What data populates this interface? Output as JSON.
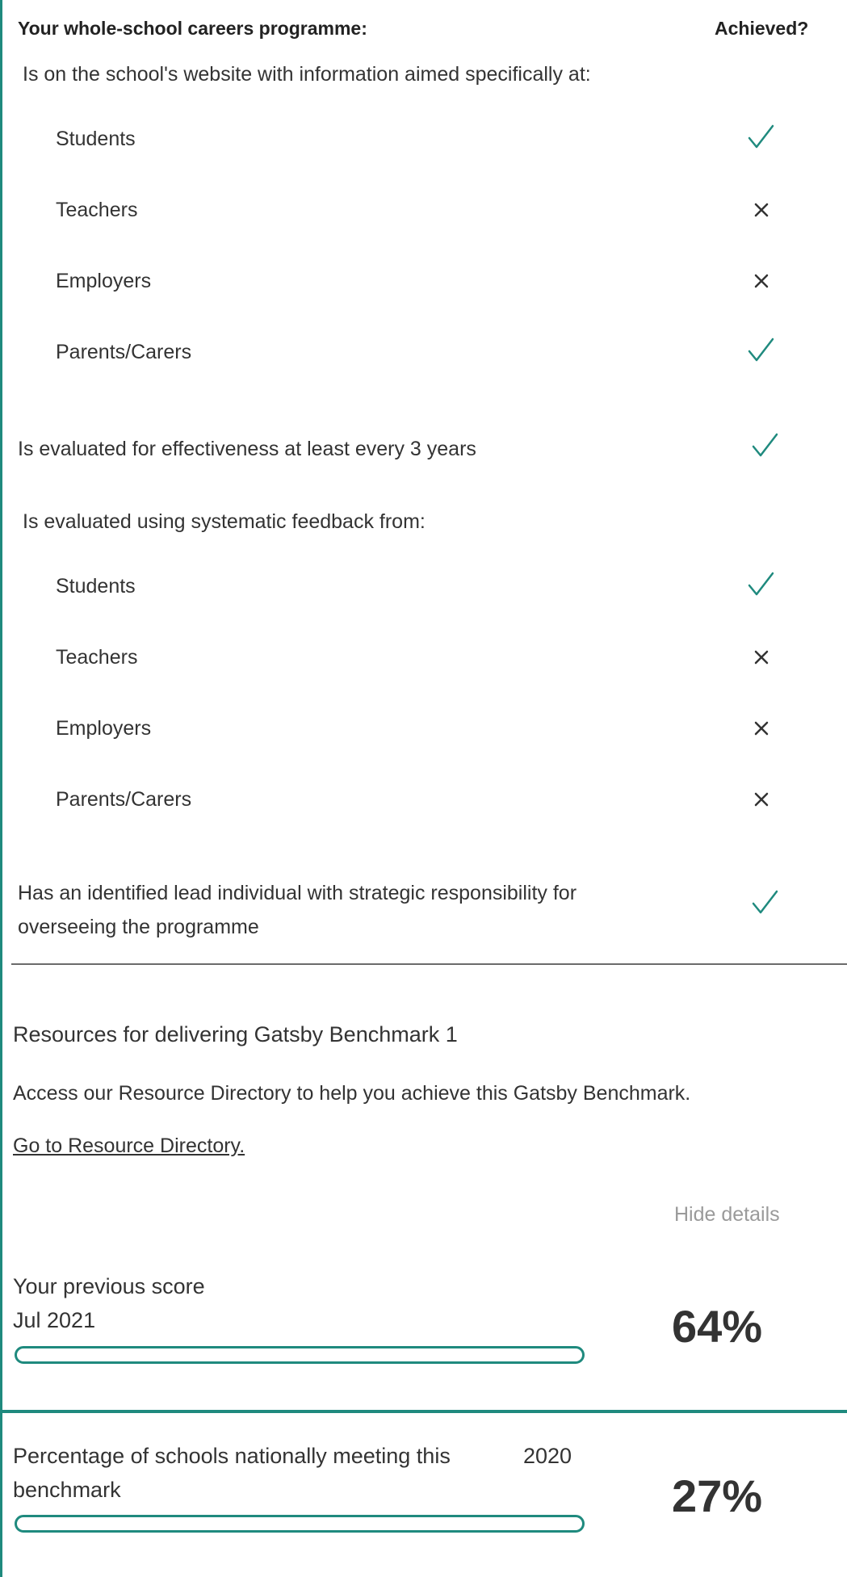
{
  "checklist": {
    "header_left": "Your whole-school careers programme:",
    "header_right": "Achieved?",
    "website_intro": "Is on the school's website with information aimed specifically at:",
    "website_items": [
      {
        "label": "Students",
        "achieved": true
      },
      {
        "label": "Teachers",
        "achieved": false
      },
      {
        "label": "Employers",
        "achieved": false
      },
      {
        "label": "Parents/Carers",
        "achieved": true
      }
    ],
    "evaluated_every": {
      "label": "Is evaluated for effectiveness at least every 3 years",
      "achieved": true
    },
    "feedback_intro": "Is evaluated using systematic feedback from:",
    "feedback_items": [
      {
        "label": "Students",
        "achieved": true
      },
      {
        "label": "Teachers",
        "achieved": false
      },
      {
        "label": "Employers",
        "achieved": false
      },
      {
        "label": "Parents/Carers",
        "achieved": false
      }
    ],
    "lead": {
      "line1": "Has an identified lead individual with strategic responsibility for",
      "line2": "overseeing the programme",
      "achieved": true
    }
  },
  "resources": {
    "title": "Resources for delivering Gatsby Benchmark 1",
    "description": "Access our Resource Directory to help you achieve this Gatsby Benchmark.",
    "link": "Go to Resource Directory."
  },
  "hide_details": "Hide details",
  "previous_score": {
    "label": "Your previous score",
    "date": "Jul 2021",
    "percent_text": "64%",
    "bar_fill_percent": 0
  },
  "national": {
    "label_line1": "Percentage of schools nationally meeting this",
    "label_line2": "benchmark",
    "year": "2020",
    "percent_text": "27%",
    "bar_fill_percent": 0
  },
  "colors": {
    "accent": "#1f8a7e",
    "cross": "#333333",
    "muted": "#9a9a9a"
  },
  "icons": {
    "achieved": "check-icon",
    "not_achieved": "cross-icon"
  }
}
